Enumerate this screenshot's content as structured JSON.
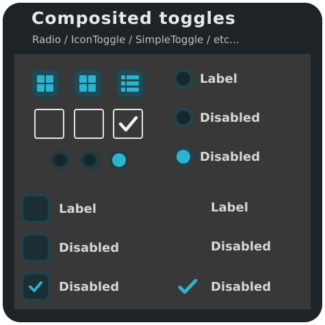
{
  "header": {
    "title": "Composited toggles",
    "subtitle": "Radio / IconToggle / SimpleToggle / etc..."
  },
  "icon_toggles": [
    {
      "icon": "grid-icon",
      "state": "on"
    },
    {
      "icon": "grid-icon",
      "state": "on"
    },
    {
      "icon": "list-icon",
      "state": "on"
    }
  ],
  "plain_checkboxes": [
    {
      "checked": false
    },
    {
      "checked": false
    },
    {
      "checked": true
    }
  ],
  "mini_radios": [
    {
      "selected": false
    },
    {
      "selected": false
    },
    {
      "selected": true
    }
  ],
  "radios": [
    {
      "label": "Label",
      "selected": false,
      "disabled": false
    },
    {
      "label": "Disabled",
      "selected": false,
      "disabled": true
    },
    {
      "label": "Disabled",
      "selected": true,
      "disabled": true
    }
  ],
  "checkboxes": [
    {
      "label": "Label",
      "checked": false,
      "disabled": false
    },
    {
      "label": "Disabled",
      "checked": false,
      "disabled": true
    },
    {
      "label": "Disabled",
      "checked": true,
      "disabled": true
    }
  ],
  "simple_toggles": [
    {
      "label": "Label",
      "checked": false
    },
    {
      "label": "Disabled",
      "checked": false
    },
    {
      "label": "Disabled",
      "checked": true
    }
  ],
  "colors": {
    "accent": "#2cb3cf",
    "panel": "#1d2326",
    "body": "#383838",
    "text": "#d6d6d6"
  }
}
